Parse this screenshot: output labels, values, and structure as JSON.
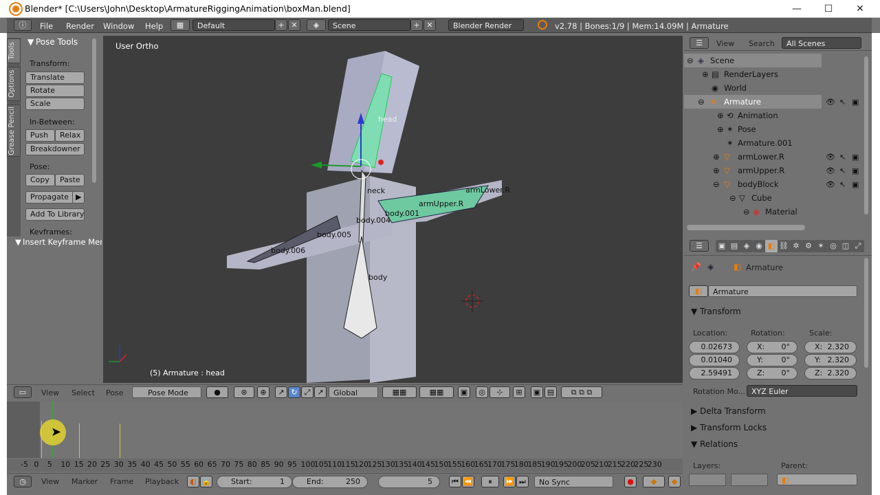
{
  "window": {
    "title": "Blender* [C:\\Users\\John\\Desktop\\ArmatureRiggingAnimation\\boxMan.blend]",
    "minimize": "—",
    "maximize": "☐",
    "close": "✕"
  },
  "menubar": {
    "items": [
      "File",
      "Render",
      "Window",
      "Help"
    ],
    "screen_layout": "Default",
    "scene": "Scene",
    "render_engine": "Blender Render",
    "info": "v2.78 | Bones:1/9 | Mem:14.09M | Armature"
  },
  "tool_tabs": [
    "Tools",
    "Options",
    "Grease Pencil"
  ],
  "pose_tools": {
    "title": "Pose Tools",
    "transform_label": "Transform:",
    "translate": "Translate",
    "rotate": "Rotate",
    "scale": "Scale",
    "inbetween_label": "In-Between:",
    "push": "Push",
    "relax": "Relax",
    "breakdowner": "Breakdowner",
    "pose_label": "Pose:",
    "copy": "Copy",
    "paste": "Paste",
    "propagate": "Propagate",
    "add_to_library": "Add To Library",
    "keyframes_label": "Keyframes:",
    "insert_keyframe_menu": "Insert Keyframe Men"
  },
  "viewport": {
    "view_label": "User Ortho",
    "status": "(5) Armature : head",
    "bone_labels": [
      "head",
      "neck",
      "body.005",
      "body.006",
      "body.004",
      "body.001",
      "body",
      "armUpper.R",
      "armLower.R"
    ]
  },
  "viewport_header": {
    "view": "View",
    "select": "Select",
    "pose": "Pose",
    "mode": "Pose Mode",
    "orientation": "Global"
  },
  "timeline": {
    "ticks": [
      "-5",
      "0",
      "5",
      "10",
      "15",
      "20",
      "25",
      "30",
      "35",
      "40",
      "45",
      "50",
      "55",
      "60",
      "65",
      "70",
      "75",
      "80",
      "85",
      "90",
      "95",
      "100",
      "105",
      "110",
      "115",
      "120",
      "125",
      "130",
      "135",
      "140",
      "145",
      "150",
      "155",
      "160",
      "165",
      "170",
      "175",
      "180",
      "185",
      "190",
      "195",
      "200",
      "205",
      "210",
      "215",
      "220",
      "225",
      "230"
    ],
    "view": "View",
    "marker": "Marker",
    "frame": "Frame",
    "playback": "Playback",
    "start_label": "Start:",
    "start": "1",
    "end_label": "End:",
    "end": "250",
    "current": "5",
    "sync": "No Sync"
  },
  "outliner": {
    "view": "View",
    "search": "Search",
    "filter": "All Scenes",
    "items": [
      "Scene",
      "RenderLayers",
      "World",
      "Armature",
      "Animation",
      "Pose",
      "Armature.001",
      "armLower.R",
      "armUpper.R",
      "bodyBlock",
      "Cube",
      "Material"
    ]
  },
  "properties": {
    "breadcrumb": "Armature",
    "object_name": "Armature",
    "transform_title": "Transform",
    "location_label": "Location:",
    "rotation_label": "Rotation:",
    "scale_label": "Scale:",
    "location": [
      "0.02673",
      "0.01040",
      "2.59491"
    ],
    "rotation": [
      "X:",
      "0°",
      "Y:",
      "0°",
      "Z:",
      "0°"
    ],
    "scale": [
      "X:",
      "2.320",
      "Y:",
      "2.320",
      "Z:",
      "2.320"
    ],
    "rotation_mode_label": "Rotation Mo...",
    "rotation_mode": "XYZ Euler",
    "delta_transform": "Delta Transform",
    "transform_locks": "Transform Locks",
    "relations": "Relations",
    "layers_label": "Layers:",
    "parent_label": "Parent:"
  },
  "colors": {
    "accent_orange": "#e87d0d",
    "bone_selected": "#7fd9b0",
    "viewport_bg": "#3d3d3d",
    "panel_bg": "#727272"
  }
}
